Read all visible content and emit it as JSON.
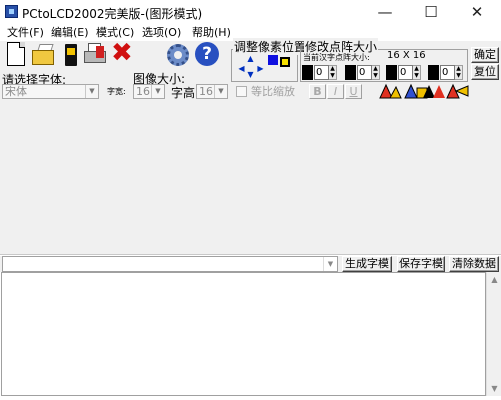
{
  "window": {
    "title": "PCtoLCD2002完美版-(图形模式)",
    "minimize": "—",
    "maximize": "☐",
    "close": "✕"
  },
  "menu": [
    "文件(F)",
    "编辑(E)",
    "模式(C)",
    "选项(O)",
    "帮助(H)"
  ],
  "toolbar": {
    "icons": [
      "new-file-icon",
      "open-folder-icon",
      "save-icon",
      "print-icon",
      "delete-icon",
      "settings-gear-icon",
      "help-icon"
    ],
    "help_glyph": "?",
    "delete_glyph": "✖"
  },
  "pixel_adjust": {
    "title": "调整像素位置"
  },
  "matrix_size": {
    "title": "修改点阵大小",
    "current_label": "当前汉字点阵大小:",
    "current_value": "16 X 16",
    "spinners": [
      "0",
      "0",
      "0",
      "0"
    ]
  },
  "confirm_button": "确定",
  "restore_button": "复位",
  "font_select": {
    "label": "请选择字体:",
    "value": "宋体"
  },
  "char_width": {
    "label": "字宽:",
    "value": "16"
  },
  "image_size": {
    "label": "图像大小:"
  },
  "char_height": {
    "label": "字高",
    "value": "16"
  },
  "proportional_scale": {
    "label": "等比缩放",
    "checked": false
  },
  "format_buttons": [
    "B",
    "I",
    "U"
  ],
  "input_combo": {
    "value": ""
  },
  "actions": {
    "generate": "生成字模",
    "save": "保存字模",
    "clear": "清除数据"
  },
  "output": {
    "text": ""
  },
  "scrollbar": {
    "up": "▲",
    "down": "▼"
  },
  "colors": {
    "window_bg": "#f0f0f0",
    "output_bg": "#ffffff",
    "help_blue": "#2850c0",
    "delete_red": "#d01010"
  }
}
